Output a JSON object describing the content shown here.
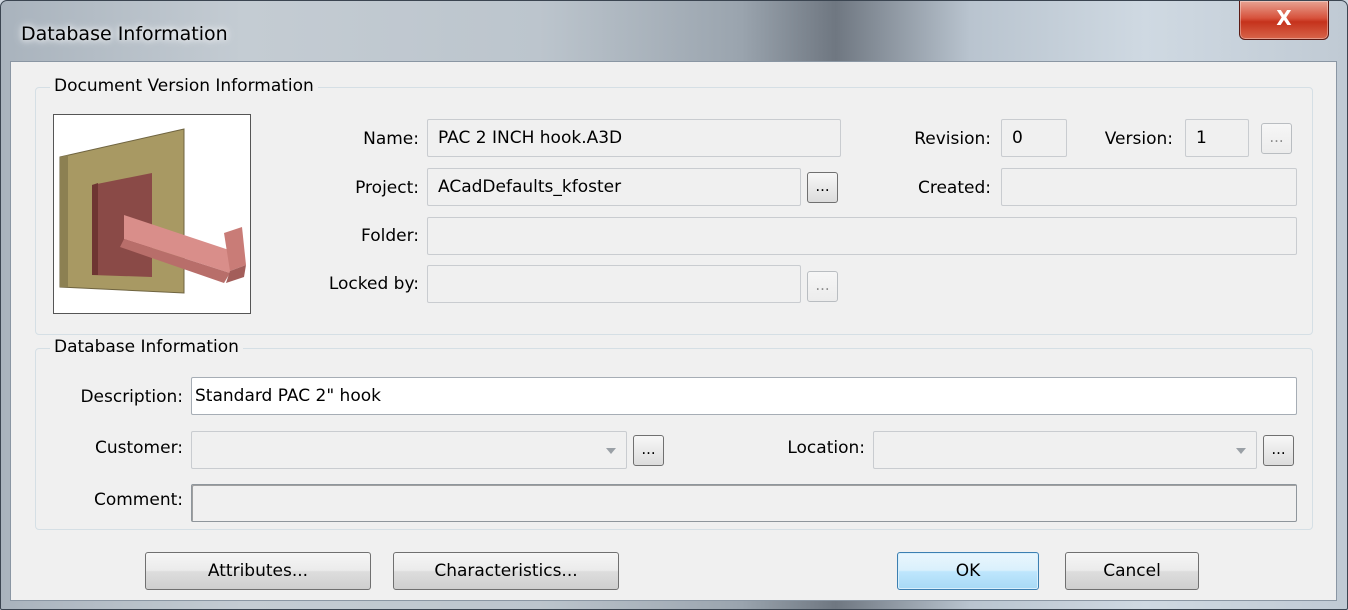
{
  "window": {
    "title": "Database Information",
    "close_glyph": "X"
  },
  "doc_group": {
    "title": "Document Version Information",
    "name_label": "Name:",
    "name_value": "PAC 2 INCH hook.A3D",
    "project_label": "Project:",
    "project_value": "ACadDefaults_kfoster",
    "folder_label": "Folder:",
    "folder_value": "",
    "locked_label": "Locked by:",
    "locked_value": "",
    "revision_label": "Revision:",
    "revision_value": "0",
    "version_label": "Version:",
    "version_value": "1",
    "created_label": "Created:",
    "created_value": ""
  },
  "db_group": {
    "title": "Database Information",
    "description_label": "Description:",
    "description_value": "Standard PAC 2\" hook",
    "customer_label": "Customer:",
    "customer_value": "",
    "location_label": "Location:",
    "location_value": "",
    "comment_label": "Comment:",
    "comment_value": ""
  },
  "ellipsis": "...",
  "buttons": {
    "attributes": "Attributes...",
    "characteristics": "Characteristics...",
    "ok": "OK",
    "cancel": "Cancel"
  },
  "icons": {
    "close": "close-icon",
    "preview": "hook-part-thumbnail",
    "dropdown": "chevron-down-icon"
  }
}
